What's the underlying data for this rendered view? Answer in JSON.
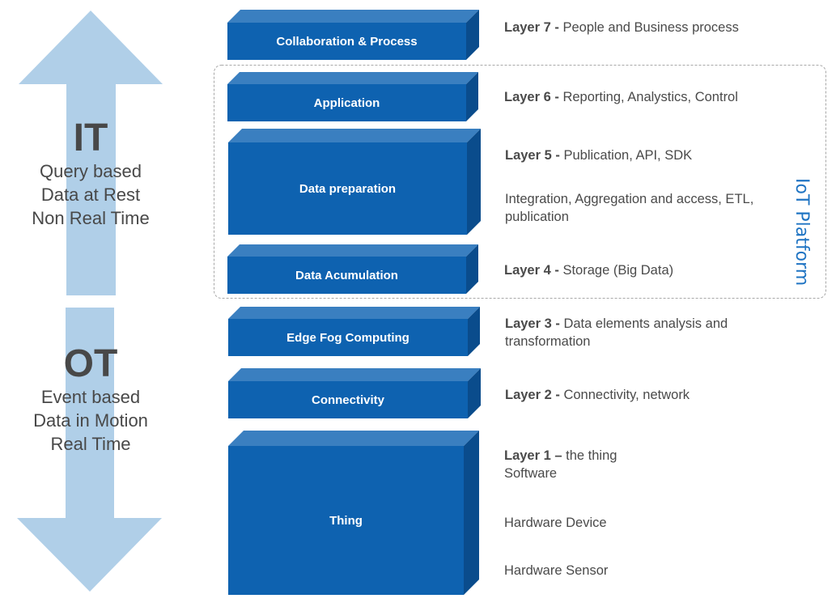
{
  "colors": {
    "block_front": "#0e62b0",
    "block_top": "#3a7fc0",
    "block_side": "#0a4c8c",
    "arrow": "#b0cfe8",
    "platform_text": "#1f74c3",
    "label_text": "#4a4a4a",
    "dashed_border": "#a8a8a8"
  },
  "left_panel": {
    "it": {
      "title": "IT",
      "lines": [
        "Query based",
        "Data at Rest",
        "Non Real Time"
      ],
      "arrow_direction": "up"
    },
    "ot": {
      "title": "OT",
      "lines": [
        "Event based",
        "Data in Motion",
        "Real Time"
      ],
      "arrow_direction": "down"
    }
  },
  "blocks": [
    {
      "label": "Collaboration & Process"
    },
    {
      "label": "Application"
    },
    {
      "label": "Data preparation"
    },
    {
      "label": "Data Acumulation"
    },
    {
      "label": "Edge Fog Computing"
    },
    {
      "label": "Connectivity"
    },
    {
      "label": "Thing"
    }
  ],
  "descriptions": {
    "layer7": {
      "bold": "Layer 7 - ",
      "text": "People and Business process"
    },
    "layer6": {
      "bold": "Layer 6 - ",
      "text": "Reporting, Analystics, Control"
    },
    "layer5": {
      "bold": "Layer 5 - ",
      "text": "Publication, API, SDK"
    },
    "layer5_extra": {
      "line1": "Integration, Aggregation and access, ETL,",
      "line2": "publication"
    },
    "layer4": {
      "bold": "Layer 4 - ",
      "text": "Storage (Big Data)"
    },
    "layer3": {
      "bold": "Layer 3 - ",
      "text": "Data elements analysis and",
      "line2": "transformation"
    },
    "layer2": {
      "bold": "Layer 2 - ",
      "text": "Connectivity, network"
    },
    "layer1": {
      "bold": "Layer 1 – ",
      "text": "the thing",
      "line2": "Software"
    },
    "layer1_device": "Hardware Device",
    "layer1_sensor": "Hardware Sensor"
  },
  "platform_group": {
    "label": "IoT Platform"
  }
}
